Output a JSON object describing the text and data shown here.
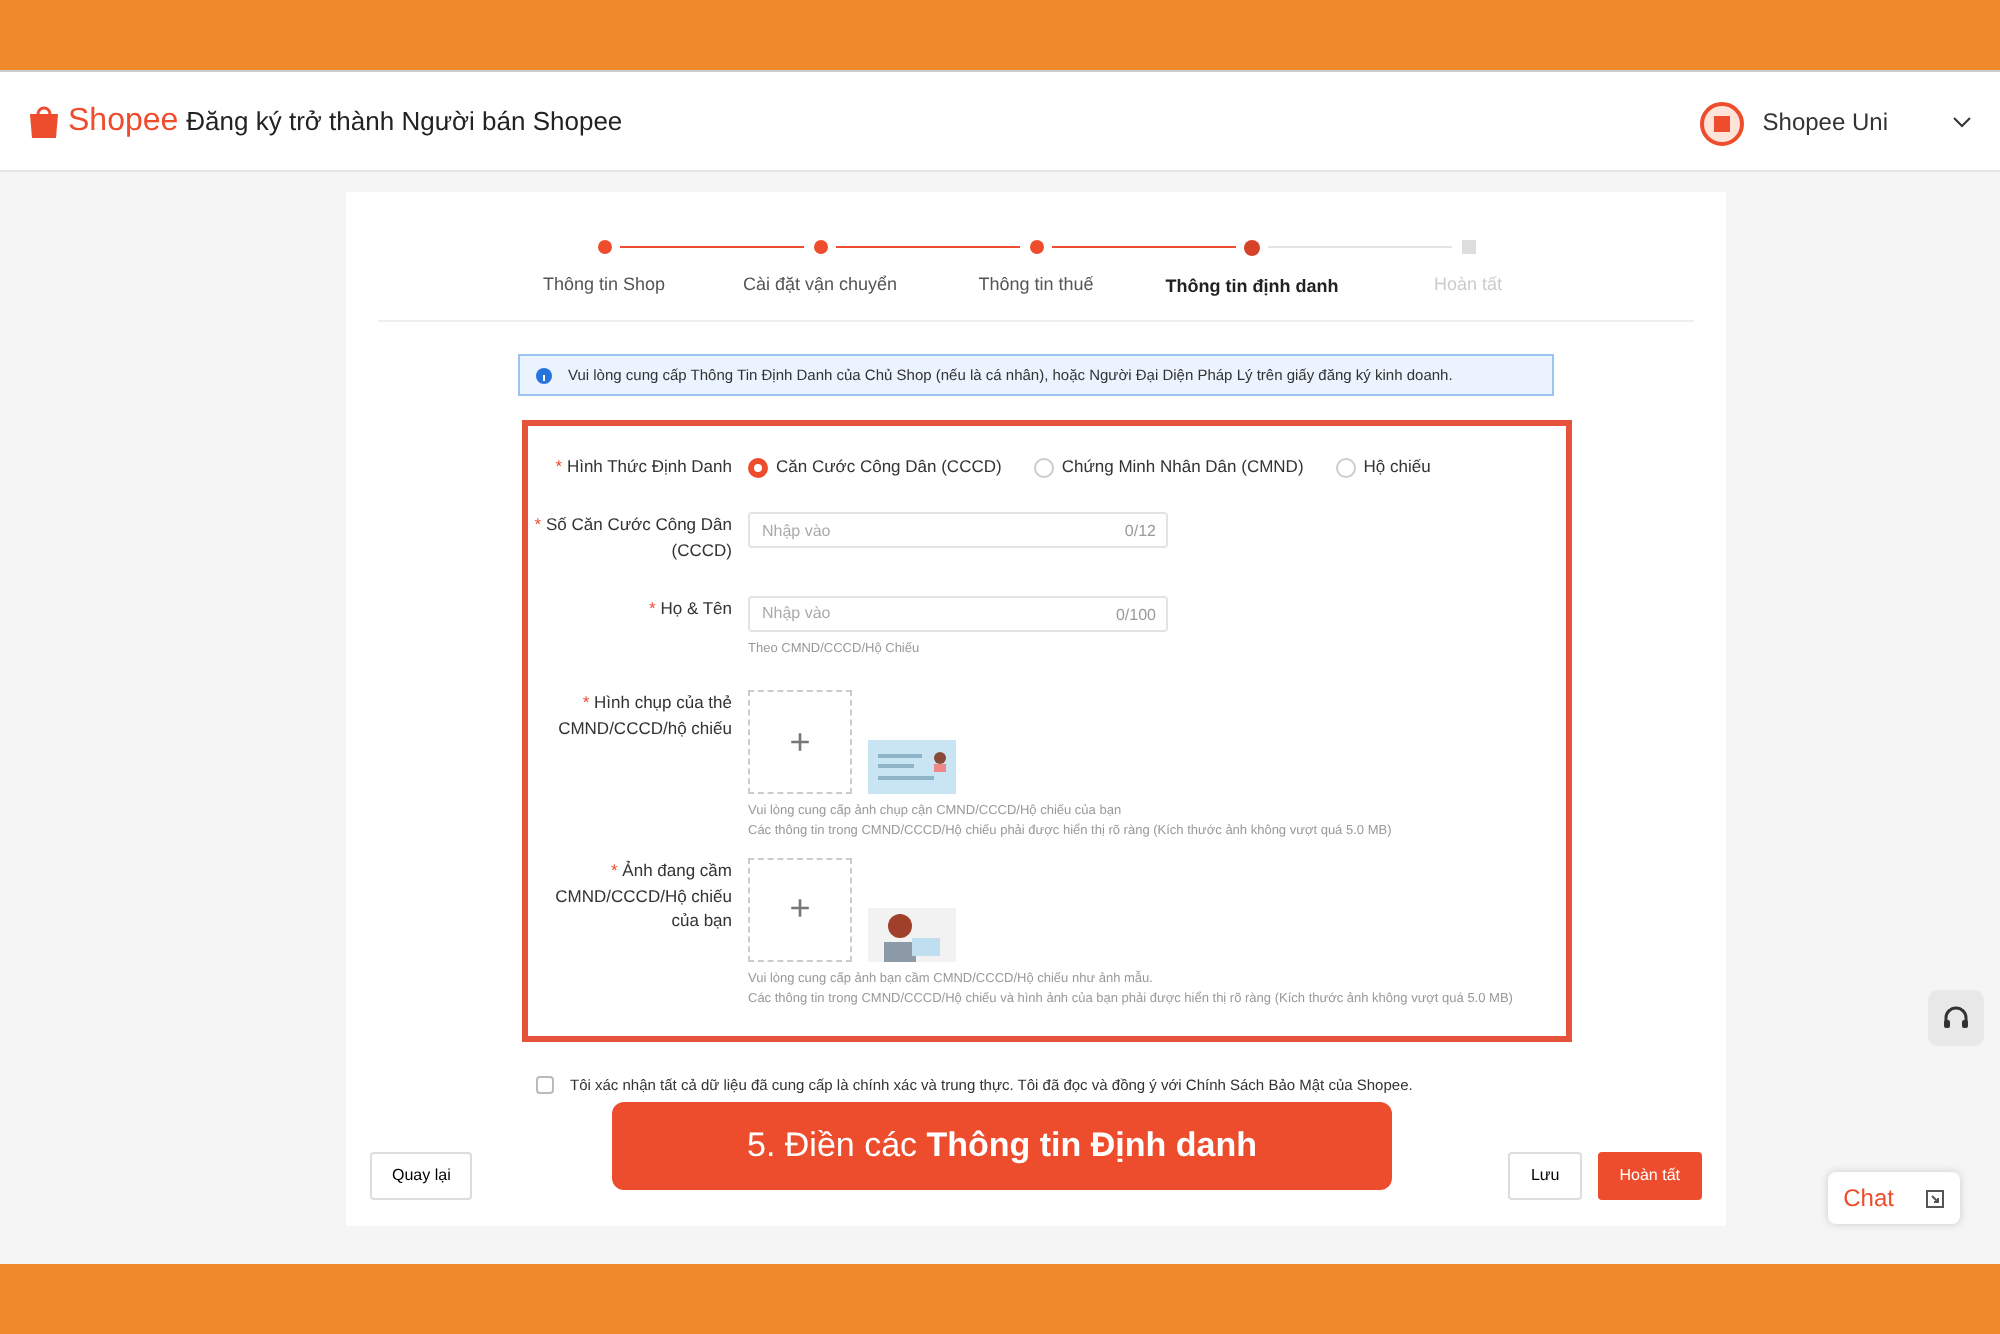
{
  "header": {
    "logo": "Shopee",
    "title": "Đăng ký trở thành Người bán Shopee",
    "account": "Shopee Uni"
  },
  "steps": [
    {
      "label": "Thông tin Shop",
      "completed": true,
      "selected": false
    },
    {
      "label": "Cài đặt vận chuyển",
      "completed": true,
      "selected": false
    },
    {
      "label": "Thông tin thuế",
      "completed": true,
      "selected": false
    },
    {
      "label": "Thông tin định danh",
      "completed": false,
      "selected": true
    },
    {
      "label": "Hoàn tất",
      "completed": false,
      "selected": false
    }
  ],
  "notice": "Vui lòng cung cấp Thông Tin Định Danh của Chủ Shop (nếu là cá nhân), hoặc Người Đại Diện Pháp Lý trên giấy đăng ký kinh doanh.",
  "id_type": {
    "label": "Hình Thức Định Danh",
    "marker": "*",
    "options": [
      {
        "label": "Căn Cước Công Dân (CCCD)",
        "selected": true
      },
      {
        "label": "Chứng Minh Nhân Dân (CMND)",
        "selected": false
      },
      {
        "label": "Hộ chiếu",
        "selected": false
      }
    ]
  },
  "fields": [
    {
      "label": "Số Căn Cước Công Dân (CCCD)",
      "marker": "*",
      "placeholder": "Nhập vào",
      "counter": "0/12"
    },
    {
      "label": "Họ & Tên",
      "marker": "*",
      "placeholder": "Nhập vào",
      "counter": "0/100",
      "hint": "Theo CMND/CCCD/Hộ Chiếu"
    }
  ],
  "uploads": [
    {
      "label": "Hình chụp của thẻ CMND/CCCD/hộ chiếu",
      "marker": "*",
      "plus": "+",
      "kind": "card",
      "hints": [
        "Vui lòng cung cấp ảnh chụp cận CMND/CCCD/Hộ chiếu của bạn",
        "Các thông tin trong CMND/CCCD/Hộ chiếu phải được hiển thị rõ ràng (Kích thước ảnh không vượt quá 5.0 MB)"
      ]
    },
    {
      "label": "Ảnh đang cầm CMND/CCCD/Hộ chiếu của bạn",
      "marker": "*",
      "plus": "+",
      "kind": "person",
      "hints": [
        "Vui lòng cung cấp ảnh bạn cầm CMND/CCCD/Hộ chiếu như ảnh mẫu.",
        "Các thông tin trong CMND/CCCD/Hộ chiếu và hình ảnh của bạn phải được hiển thị rõ ràng (Kích thước ảnh không vượt quá 5.0 MB)"
      ]
    }
  ],
  "agreement": {
    "text": "Tôi xác nhận tất cả dữ liệu đã cung cấp là chính xác và trung thực. Tôi đã đọc và đồng ý với Chính Sách Bảo Mật của Shopee.",
    "checked": false
  },
  "banner": "5. Điền các **Thông tin Định danh**",
  "buttons": {
    "back": "Quay lại",
    "save": "Lưu",
    "finish": "Hoàn tất"
  },
  "chat": "Chat"
}
